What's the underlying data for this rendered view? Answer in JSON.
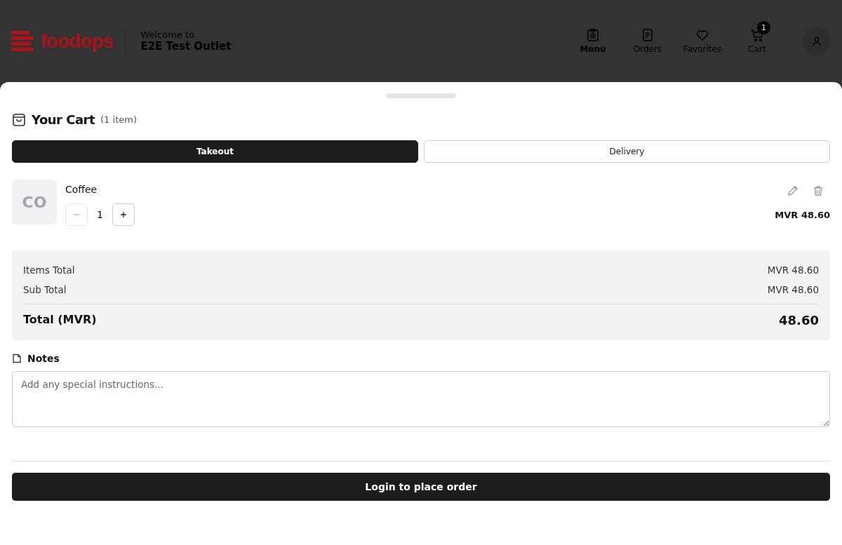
{
  "header": {
    "brand": "foodops",
    "welcome": "Welcome to",
    "outlet": "E2E Test Outlet",
    "nav": [
      {
        "label": "Menu",
        "kind": "menu",
        "selected": true
      },
      {
        "label": "Orders",
        "kind": "orders",
        "selected": false
      },
      {
        "label": "Favorites",
        "kind": "favorites",
        "selected": false
      },
      {
        "label": "Cart",
        "kind": "cart",
        "selected": false,
        "badge": "1"
      }
    ]
  },
  "cart": {
    "title": "Your Cart",
    "count": "(1 item)",
    "tabs": [
      {
        "label": "Takeout",
        "selected": true
      },
      {
        "label": "Delivery",
        "selected": false
      }
    ],
    "items": [
      {
        "initials": "CO",
        "name": "Coffee",
        "quantity": "1",
        "price": "MVR 48.60",
        "minus_disabled": true
      }
    ],
    "summary": [
      {
        "label": "Items Total",
        "value": "MVR 48.60"
      },
      {
        "label": "Sub Total",
        "value": "MVR 48.60"
      }
    ],
    "total": {
      "label": "Total (MVR)",
      "value": "48.60"
    },
    "notes": {
      "label": "Notes",
      "placeholder": "Add any special instructions..."
    },
    "action": "Login to place order"
  }
}
